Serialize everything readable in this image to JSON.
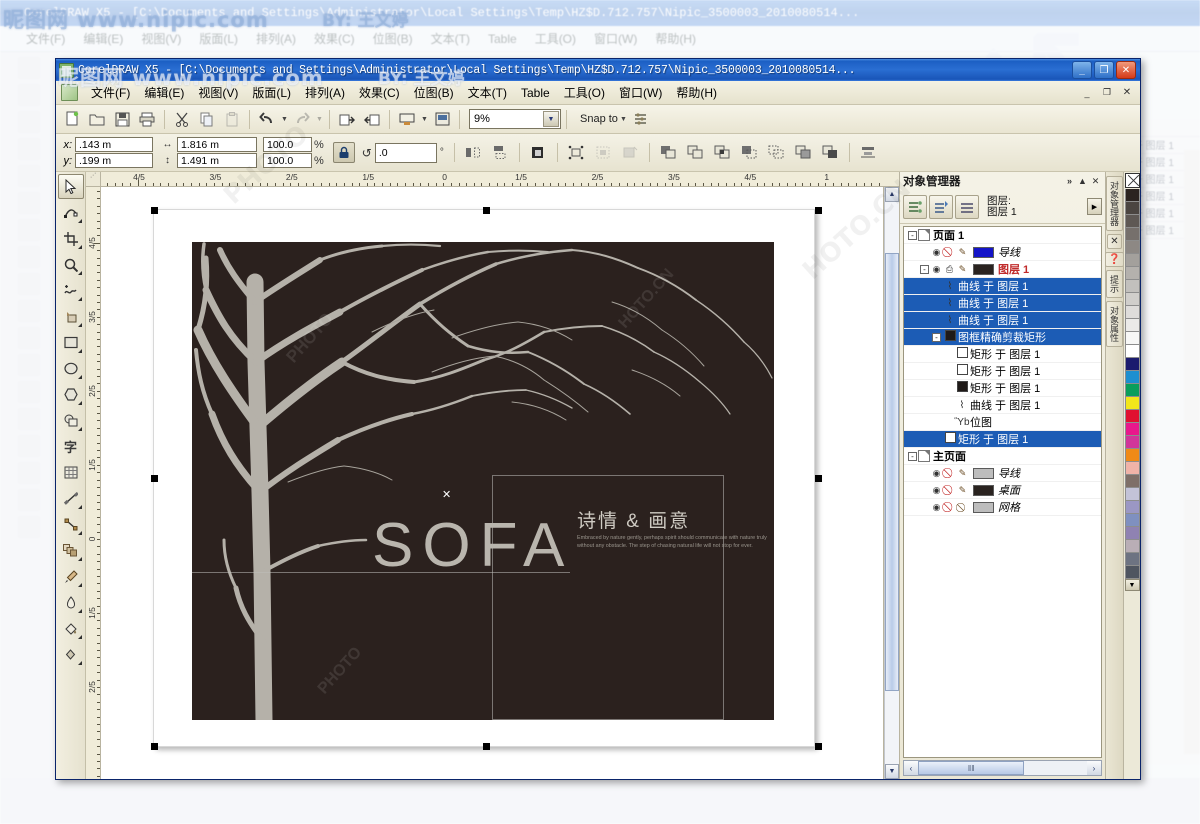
{
  "window": {
    "title": "CorelDRAW X5 - [C:\\Documents and Settings\\Administrator\\Local Settings\\Temp\\HZ$D.712.757\\Nipic_3500003_2010080514...",
    "minimize_label": "_",
    "maximize_label": "❐",
    "close_label": "✕",
    "inner_minimize": "_",
    "inner_restore": "❐",
    "inner_close": "✕"
  },
  "watermark": {
    "site": "昵图网 www.nipic.com",
    "author": "BY: 王文婷",
    "ghost": "PHOTO",
    "ghost2": "HOTO.CN"
  },
  "menu": {
    "items": [
      {
        "label": "文件(F)"
      },
      {
        "label": "编辑(E)"
      },
      {
        "label": "视图(V)"
      },
      {
        "label": "版面(L)"
      },
      {
        "label": "排列(A)"
      },
      {
        "label": "效果(C)"
      },
      {
        "label": "位图(B)"
      },
      {
        "label": "文本(T)"
      },
      {
        "label": "Table"
      },
      {
        "label": "工具(O)"
      },
      {
        "label": "窗口(W)"
      },
      {
        "label": "帮助(H)"
      }
    ]
  },
  "toolbar": {
    "buttons": [
      {
        "name": "new-document-icon",
        "glyph": "὜b"
      },
      {
        "name": "open-document-icon",
        "glyph": "Ὄ2"
      },
      {
        "name": "save-document-icon",
        "glyph": "὚b"
      },
      {
        "name": "print-icon",
        "glyph": "Ὓ6"
      },
      {
        "name": "cut-icon",
        "glyph": "✂"
      },
      {
        "name": "copy-icon",
        "glyph": "Ὕ0"
      },
      {
        "name": "paste-icon",
        "glyph": "Ὄb"
      },
      {
        "name": "undo-icon",
        "glyph": "↶"
      },
      {
        "name": "redo-icon",
        "glyph": "↷"
      },
      {
        "name": "import-icon",
        "glyph": "⬋"
      },
      {
        "name": "export-icon",
        "glyph": "⬏"
      },
      {
        "name": "application-launcher-icon",
        "glyph": "Ὓ5"
      },
      {
        "name": "options-icon",
        "glyph": "Ὓc"
      }
    ],
    "zoom_level": "9%",
    "snap_to_label": "Snap to",
    "dropdown_glyph": "▼"
  },
  "property_bar": {
    "x_label": "x:",
    "y_label": "y:",
    "x_value": ".143 m",
    "y_value": ".199 m",
    "width_value": "1.816 m",
    "height_value": "1.491 m",
    "scale_h": "100.0",
    "scale_v": "100.0",
    "percent_symbol": "%",
    "lock_icon": "ὑ2",
    "rotation_value": ".0",
    "rotation_unit": "°",
    "width_icon": "↔",
    "height_icon": "↕",
    "rotate_icon": "↺",
    "buttons": [
      {
        "name": "mirror-horizontal-icon",
        "glyph": "⧉"
      },
      {
        "name": "mirror-vertical-icon",
        "glyph": "⥁"
      },
      {
        "name": "outline-width-icon",
        "glyph": "⬛"
      },
      {
        "name": "convert-to-curves-icon",
        "glyph": "✸"
      },
      {
        "name": "text-wrap-icon",
        "glyph": "▣"
      },
      {
        "name": "wrap-offset-icon",
        "glyph": "▤"
      },
      {
        "name": "weld-icon",
        "glyph": "❐"
      },
      {
        "name": "trim-icon",
        "glyph": "❑"
      },
      {
        "name": "intersect-icon",
        "glyph": "◨"
      },
      {
        "name": "simplify-icon",
        "glyph": "◫"
      },
      {
        "name": "front-minus-back-icon",
        "glyph": "◰"
      },
      {
        "name": "back-minus-front-icon",
        "glyph": "◳"
      },
      {
        "name": "create-boundary-icon",
        "glyph": "◧"
      },
      {
        "name": "align-distribute-icon",
        "glyph": "⬒"
      }
    ]
  },
  "toolbox": {
    "tools": [
      {
        "name": "pick-tool",
        "glyph": "➤",
        "active": true,
        "flyout": false
      },
      {
        "name": "shape-tool",
        "glyph": "✒",
        "active": false,
        "flyout": true
      },
      {
        "name": "crop-tool",
        "glyph": "✀",
        "active": false,
        "flyout": true
      },
      {
        "name": "zoom-tool",
        "glyph": "ὐd",
        "active": false,
        "flyout": true
      },
      {
        "name": "freehand-tool",
        "glyph": "∿",
        "active": false,
        "flyout": true
      },
      {
        "name": "smart-fill-tool",
        "glyph": "Ὗ9",
        "active": false,
        "flyout": true
      },
      {
        "name": "rectangle-tool",
        "glyph": "□",
        "active": false,
        "flyout": true
      },
      {
        "name": "ellipse-tool",
        "glyph": "○",
        "active": false,
        "flyout": true
      },
      {
        "name": "polygon-tool",
        "glyph": "⬡",
        "active": false,
        "flyout": true
      },
      {
        "name": "basic-shapes-tool",
        "glyph": "⬟",
        "active": false,
        "flyout": true
      },
      {
        "name": "text-tool",
        "glyph": "字",
        "active": false,
        "flyout": false
      },
      {
        "name": "table-tool",
        "glyph": "▦",
        "active": false,
        "flyout": false
      },
      {
        "name": "dimension-tool",
        "glyph": "╱",
        "active": false,
        "flyout": true
      },
      {
        "name": "connector-tool",
        "glyph": "↗",
        "active": false,
        "flyout": true
      },
      {
        "name": "blend-tool",
        "glyph": "⧉",
        "active": false,
        "flyout": true
      },
      {
        "name": "color-eyedropper-tool",
        "glyph": "὘c",
        "active": false,
        "flyout": true
      },
      {
        "name": "outline-pen-tool",
        "glyph": "὘b",
        "active": false,
        "flyout": true
      },
      {
        "name": "fill-tool",
        "glyph": "ᾪ3",
        "active": false,
        "flyout": true
      },
      {
        "name": "interactive-fill-tool",
        "glyph": "◈",
        "active": false,
        "flyout": true
      }
    ]
  },
  "rulers": {
    "unit_label": "meters",
    "h_ticks": [
      "4/5",
      "3/5",
      "2/5",
      "1/5",
      "0",
      "1/5",
      "2/5",
      "3/5",
      "4/5",
      "1"
    ],
    "v_ticks": [
      "4/5",
      "3/5",
      "2/5",
      "1/5",
      "0",
      "1/5",
      "2/5"
    ],
    "corner_glyph": "⋰"
  },
  "artwork": {
    "title_text": "SOFA",
    "chinese_title": "诗情 & 画意",
    "body_text": "Embraced by nature gently, perhaps spirit should communicate with nature truly without any obstacle. The step of chasing natural life will not stop for ever.",
    "cursor_glyph": "✕"
  },
  "docker": {
    "title": "对象管理器",
    "expand_glyph": "»",
    "collapse_glyph": "▲",
    "close_glyph": "✕",
    "layer_label_line1": "图层:",
    "layer_label_line2": "图层 1",
    "tool_buttons": [
      {
        "name": "show-object-properties-icon",
        "glyph": "≣"
      },
      {
        "name": "edit-across-layers-icon",
        "glyph": "≡"
      },
      {
        "name": "layer-manager-view-icon",
        "glyph": "☰"
      }
    ],
    "flyout_glyph": "▶",
    "tree": [
      {
        "name": "page-node",
        "indent": 0,
        "expander": "-",
        "icon": "page",
        "label": "页面  1",
        "bold": true,
        "selected": false,
        "chip": "",
        "eye": false
      },
      {
        "name": "guides-layer",
        "indent": 1,
        "expander": "",
        "icon": "",
        "label": "导线",
        "italic": true,
        "chip": "#1414c8",
        "eye": true,
        "noprint": true,
        "pencil": true,
        "selected": false
      },
      {
        "name": "layer-1",
        "indent": 1,
        "expander": "-",
        "icon": "",
        "label": "图层  1",
        "red": true,
        "chip": "#2a2320",
        "eye": true,
        "printer": true,
        "pencil": true,
        "selected": false
      },
      {
        "name": "curve-object",
        "indent": 2,
        "expander": "",
        "icon": "curve",
        "label": "曲线  于  图层  1",
        "selected": true
      },
      {
        "name": "curve-object",
        "indent": 2,
        "expander": "",
        "icon": "curve",
        "label": "曲线  于  图层  1",
        "selected": true
      },
      {
        "name": "curve-object",
        "indent": 2,
        "expander": "",
        "icon": "curve",
        "label": "曲线  于  图层  1",
        "selected": true
      },
      {
        "name": "powerclip-rectangle",
        "indent": 2,
        "expander": "-",
        "icon": "swatch-dark",
        "label": "图框精确剪裁矩形",
        "selected": true
      },
      {
        "name": "rectangle-object",
        "indent": 3,
        "expander": "",
        "icon": "swatch-white",
        "label": "矩形  于  图层  1",
        "selected": false
      },
      {
        "name": "rectangle-object",
        "indent": 3,
        "expander": "",
        "icon": "swatch-white",
        "label": "矩形  于  图层  1",
        "selected": false
      },
      {
        "name": "rectangle-object",
        "indent": 3,
        "expander": "",
        "icon": "swatch-dark",
        "label": "矩形  于  图层  1",
        "selected": false
      },
      {
        "name": "curve-object",
        "indent": 3,
        "expander": "",
        "icon": "curve",
        "label": "曲线  于  图层  1",
        "selected": false
      },
      {
        "name": "bitmap-object",
        "indent": 3,
        "expander": "",
        "icon": "bitmap",
        "label": "位图",
        "selected": false
      },
      {
        "name": "rectangle-object",
        "indent": 2,
        "expander": "",
        "icon": "swatch-white",
        "label": "矩形  于  图层  1",
        "selected": true
      },
      {
        "name": "master-page-node",
        "indent": 0,
        "expander": "-",
        "icon": "page",
        "label": "主页面",
        "bold": true,
        "selected": false
      },
      {
        "name": "master-guides-layer",
        "indent": 1,
        "expander": "",
        "icon": "",
        "label": "导线",
        "italic": true,
        "chip": "#bdbdbd",
        "eye": true,
        "noprint": true,
        "pencil": true,
        "selected": false
      },
      {
        "name": "desktop-layer",
        "indent": 1,
        "expander": "",
        "icon": "",
        "label": "桌面",
        "italic": true,
        "chip": "#2a2320",
        "eye": true,
        "noprint": true,
        "pencil": true,
        "selected": false
      },
      {
        "name": "grid-layer",
        "indent": 1,
        "expander": "",
        "icon": "",
        "label": "网格",
        "italic": true,
        "chip": "#bdbdbd",
        "eye": true,
        "noprint": true,
        "pencil2": true,
        "selected": false
      }
    ],
    "hscroll": {
      "left_glyph": "‹",
      "right_glyph": "›",
      "grip": "‖‖"
    }
  },
  "side_tabs": [
    {
      "name": "tab-object-manager",
      "label": "对象管理器"
    },
    {
      "name": "tab-close",
      "label": "✕",
      "horizontal": true
    },
    {
      "name": "tab-help",
      "label": "❓",
      "horizontal": true
    },
    {
      "name": "tab-hints",
      "label": "提示"
    },
    {
      "name": "tab-object-properties",
      "label": "对象属性"
    }
  ],
  "scrollbars": {
    "up_glyph": "▲",
    "down_glyph": "▼",
    "left_glyph": "◀",
    "right_glyph": "▶"
  },
  "palette": {
    "no_color_label": "✕",
    "more_glyph": "▼",
    "colors": [
      "#2b2320",
      "#4b4541",
      "#5e5854",
      "#76706c",
      "#8d8884",
      "#a3a09c",
      "#b4b1ad",
      "#c2c0bd",
      "#d0cecb",
      "#dedcda",
      "#ebeae8",
      "#f7f7f6",
      "#ffffff",
      "#1b1b6e",
      "#1d8fd0",
      "#0a9e5c",
      "#f2e61a",
      "#e01030",
      "#e8188c",
      "#d1359a",
      "#f08a16",
      "#f0b3a8",
      "#7e6f68",
      "#c3c3d8",
      "#9b97c4",
      "#7f90c0",
      "#8f82b2",
      "#b9aeb6",
      "#6d7382",
      "#4f5560"
    ]
  }
}
